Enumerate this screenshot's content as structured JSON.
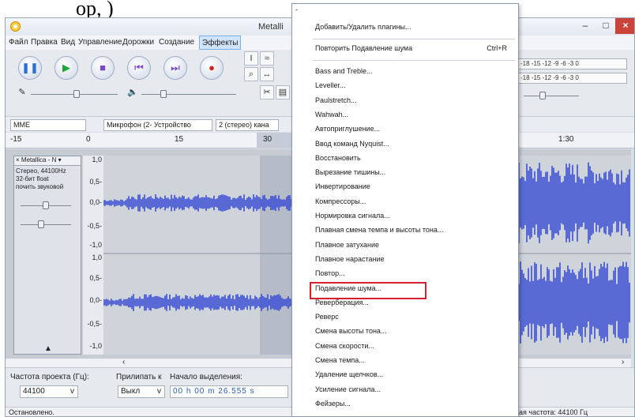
{
  "page_text_fragment": "ор, )",
  "window": {
    "title": "Metalli"
  },
  "menubar": [
    "Файл",
    "Правка",
    "Вид",
    "Управление",
    "Дорожки",
    "Создание",
    "Эффекты"
  ],
  "device_bar": {
    "host": "MME",
    "mic": "Микрофон (2- Устройство",
    "channels": "2 (стерео) кана"
  },
  "ruler": {
    "labels": [
      "-15",
      "0",
      "15",
      "30",
      "1:30"
    ]
  },
  "track": {
    "title": "Metallica - N",
    "info": [
      "Стерео, 44100Hz",
      "32-бит float",
      "почить звуковой"
    ],
    "scale_top": [
      "1,0",
      "0,5-",
      "0,0-",
      "-0,5-",
      "-1,0"
    ],
    "scale_bottom": [
      "1,0",
      "0,5-",
      "0,0-",
      "-0,5-",
      "-1,0"
    ]
  },
  "meters": [
    "-18 -15 -12 -9 -6 -3 0",
    "-18 -15 -12 -9 -6 -3 0"
  ],
  "selection_bar": {
    "rate_label": "Частота проекта (Гц):",
    "rate_value": "44100",
    "snap_label": "Прилипать к",
    "snap_value": "Выкл",
    "start_label": "Начало выделения:",
    "start_value": "00 h 00 m 26.555 s"
  },
  "status": {
    "left": "Остановлено.",
    "right": "ая частота: 44100 Гц"
  },
  "effects_menu": {
    "top_items": [
      "Добавить/Удалить плагины..."
    ],
    "repeat": {
      "label": "Повторить Подавление шума",
      "shortcut": "Ctrl+R"
    },
    "items": [
      "Bass and Treble...",
      "Leveller...",
      "Paulstretch...",
      "Wahwah...",
      "Автоприглушение...",
      "Ввод команд Nyquist...",
      "Восстановить",
      "Вырезание тишины...",
      "Инвертирование",
      "Компрессоры...",
      "Нормировка сигнала...",
      "Плавная смена темпа и высоты тона...",
      "Плавное затухание",
      "Плавное нарастание",
      "Повтор...",
      "Подавление шума...",
      "Реверберация...",
      "Реверс",
      "Смена высоты тона...",
      "Смена скорости...",
      "Смена темпа...",
      "Удаление щелчков...",
      "Усиление сигнала...",
      "Фейзеры..."
    ],
    "highlighted": "Подавление шума..."
  }
}
